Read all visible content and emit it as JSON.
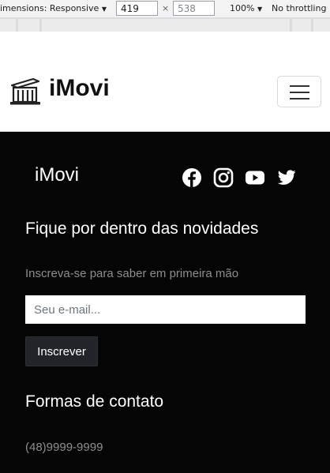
{
  "devtools": {
    "dimensions_label": "imensions: Responsive",
    "width_value": "419",
    "height_value": "538",
    "times_symbol": "×",
    "zoom_label": "100%",
    "throttling_label": "No throttling"
  },
  "navbar": {
    "brand_icon": "building-icon",
    "brand_name": "iMovi",
    "toggler_icon": "hamburger-menu-icon"
  },
  "footer": {
    "brand_name": "iMovi",
    "social_icons": [
      "facebook-icon",
      "instagram-icon",
      "youtube-icon",
      "twitter-icon"
    ],
    "newsletter": {
      "heading": "Fique por dentro das novidades",
      "subtitle": "Inscreva-se para saber em primeira mão",
      "email_placeholder": "Seu e-mail...",
      "subscribe_label": "Inscrever"
    },
    "contact": {
      "heading": "Formas de contato",
      "phone": "(48)9999-9999"
    }
  },
  "colors": {
    "footer_bg": "#050505",
    "button_bg": "#212529",
    "muted_text": "#8e8e8e"
  }
}
